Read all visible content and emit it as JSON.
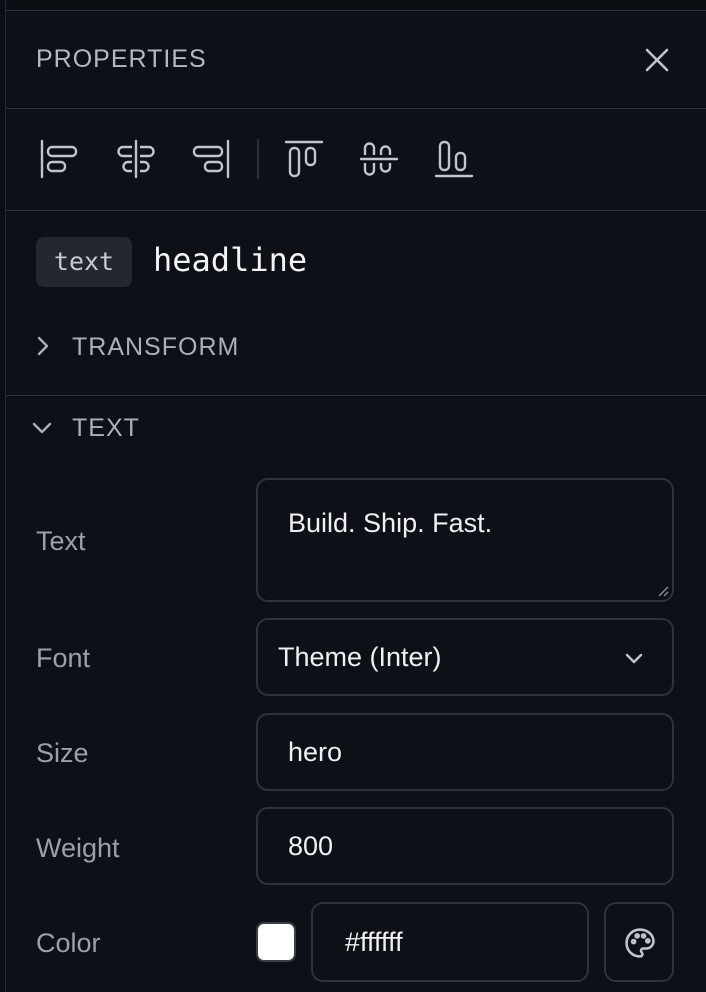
{
  "panel": {
    "title": "PROPERTIES"
  },
  "icons": {
    "close": "close-icon",
    "align": [
      "align-left-icon",
      "align-center-horizontal-icon",
      "align-right-icon",
      "align-top-icon",
      "align-center-vertical-icon",
      "align-bottom-icon"
    ],
    "color_picker": "palette-icon"
  },
  "element": {
    "type": "text",
    "name": "headline"
  },
  "sections": {
    "transform": {
      "label": "TRANSFORM",
      "expanded": false
    },
    "text": {
      "label": "TEXT",
      "expanded": true
    }
  },
  "fields": {
    "text": {
      "label": "Text",
      "value": "Build. Ship. Fast."
    },
    "font": {
      "label": "Font",
      "value": "Theme (Inter)"
    },
    "size": {
      "label": "Size",
      "value": "hero"
    },
    "weight": {
      "label": "Weight",
      "value": "800"
    },
    "color": {
      "label": "Color",
      "value": "#ffffff",
      "swatch": "#ffffff"
    }
  },
  "colors": {
    "background": "#0d1016",
    "border": "#2d323b",
    "muted_text": "#9aa1ab"
  }
}
